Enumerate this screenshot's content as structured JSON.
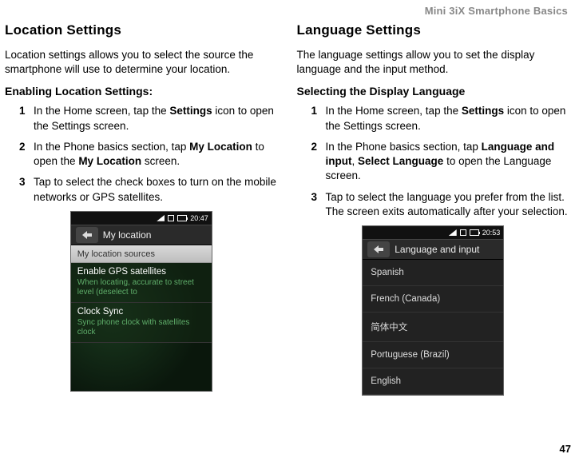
{
  "header": "Mini 3iX Smartphone Basics",
  "pageNumber": "47",
  "left": {
    "h2": "Location Settings",
    "intro": "Location settings allows you to select the source the smartphone will use to determine your location.",
    "h3": "Enabling Location Settings:",
    "steps": {
      "s1a": "In the Home screen, tap the ",
      "s1b": "Settings",
      "s1c": " icon to open the Settings screen.",
      "s2a": "In the Phone basics section, tap ",
      "s2b": "My Location",
      "s2c": " to open the ",
      "s2d": "My Location",
      "s2e": " screen.",
      "s3": "Tap to select the check boxes to turn on the mobile networks or GPS satellites."
    },
    "shot": {
      "time": "20:47",
      "title": "My location",
      "section": "My location sources",
      "row1": {
        "lbl": "Enable GPS satellites",
        "sub": "When locating, accurate to street level (deselect to"
      },
      "row2": {
        "lbl": "Clock Sync",
        "sub": "Sync phone clock with satellites clock"
      }
    }
  },
  "right": {
    "h2": "Language Settings",
    "intro": "The language settings allow you to set the display language and the input method.",
    "h3": "Selecting the Display Language",
    "steps": {
      "s1a": "In the Home screen, tap the ",
      "s1b": "Settings",
      "s1c": " icon to open the Settings screen.",
      "s2a": "In the Phone basics section, tap ",
      "s2b": "Language and input",
      "s2c": ", ",
      "s2d": "Select Language",
      "s2e": " to open the Language screen.",
      "s3": "Tap to select the language you prefer from the list. The screen exits automatically after your selection."
    },
    "shot": {
      "time": "20:53",
      "title": "Language and input",
      "langs": {
        "l1": "Spanish",
        "l2": "French (Canada)",
        "l3": "简体中文",
        "l4": "Portuguese (Brazil)",
        "l5": "English"
      }
    }
  }
}
